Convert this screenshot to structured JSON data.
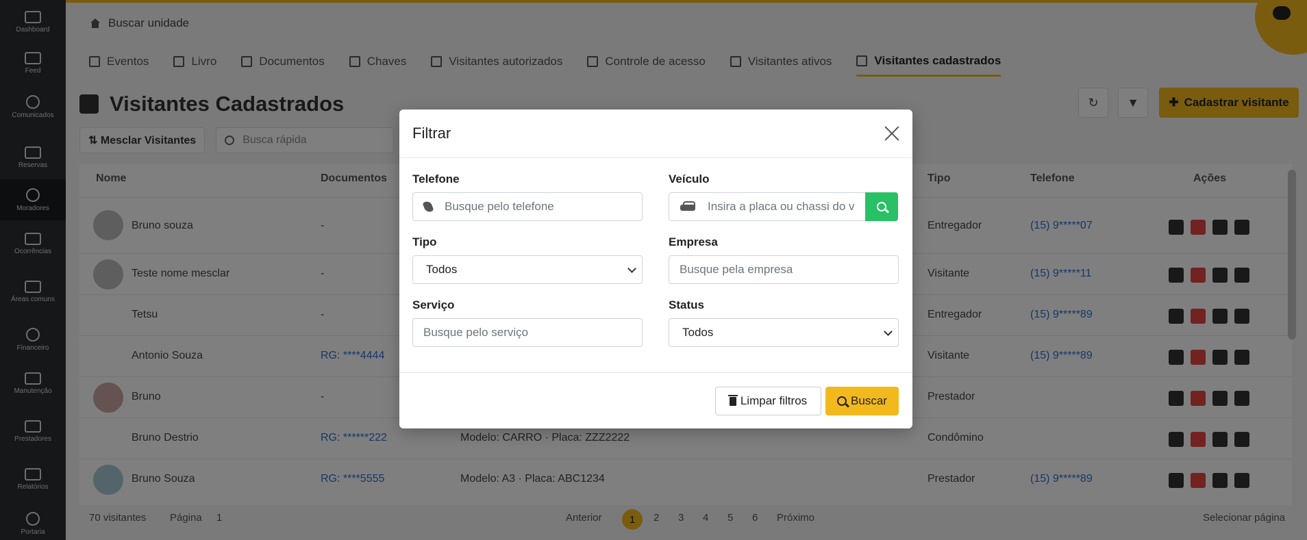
{
  "nav": {
    "items": [
      {
        "label": "Dashboard",
        "top": 0
      },
      {
        "label": "Feed"
      },
      {
        "label": "Comunicados"
      },
      {
        "label": "Reservas"
      },
      {
        "label": "Moradores"
      },
      {
        "label": "Ocorrências"
      },
      {
        "label": "Áreas comuns"
      },
      {
        "label": "Financeiro"
      },
      {
        "label": "Manutenção"
      },
      {
        "label": "Prestadores"
      },
      {
        "label": "Relatórios"
      },
      {
        "label": "Portaria"
      }
    ]
  },
  "header": {
    "breadcrumb": "Buscar unidade"
  },
  "tabs": [
    "Eventos",
    "Livro",
    "Documentos",
    "Chaves",
    "Visitantes autorizados",
    "Controle de acesso",
    "Visitantes ativos",
    "Visitantes cadastrados"
  ],
  "page": {
    "title": "Visitantes Cadastrados",
    "add_button": "Cadastrar visitante",
    "merge_button": "Mesclar Visitantes",
    "quick_search_placeholder": "Busca rápida"
  },
  "table": {
    "headers": [
      "Nome",
      "Documentos",
      "Tipo",
      "Telefone",
      "Ações"
    ],
    "rows": [
      {
        "name": "Bruno souza",
        "document": "-",
        "vehicle": "",
        "type": "Entregador",
        "phone": "(15) 9*****07"
      },
      {
        "name": "Teste nome mesclar",
        "document": "-",
        "vehicle": "",
        "type": "Visitante",
        "phone": "(15) 9*****11"
      },
      {
        "name": "Tetsu",
        "document": "-",
        "vehicle": "",
        "type": "Entregador",
        "phone": "(15) 9*****89"
      },
      {
        "name": "Antonio Souza",
        "document": "RG: ****4444",
        "vehicle": "",
        "type": "Visitante",
        "phone": "(15) 9*****89"
      },
      {
        "name": "Bruno",
        "document": "-",
        "vehicle": "",
        "type": "Prestador",
        "phone": ""
      },
      {
        "name": "Bruno Destrio",
        "document": "RG: ******222",
        "vehicle": "Modelo: CARRO · Placa: ZZZ2222",
        "type": "Condômino",
        "phone": ""
      },
      {
        "name": "Bruno Souza",
        "document": "RG: ****5555",
        "vehicle": "Modelo: A3 · Placa: ABC1234",
        "type": "Prestador",
        "phone": "(15) 9*****89"
      }
    ]
  },
  "pager": {
    "summary": "70 visitantes",
    "page_label": "Página",
    "page_value": "1",
    "prev": "Anterior",
    "pages": [
      "1",
      "2",
      "3",
      "4",
      "5",
      "6"
    ],
    "next": "Próximo",
    "select_all": "Selecionar página"
  },
  "modal": {
    "title": "Filtrar",
    "telefone": {
      "label": "Telefone",
      "placeholder": "Busque pelo telefone"
    },
    "veiculo": {
      "label": "Veículo",
      "placeholder": "Insira a placa ou chassi do v"
    },
    "tipo": {
      "label": "Tipo",
      "value": "Todos"
    },
    "empresa": {
      "label": "Empresa",
      "placeholder": "Busque pela empresa"
    },
    "servico": {
      "label": "Serviço",
      "placeholder": "Busque pelo serviço"
    },
    "status": {
      "label": "Status",
      "value": "Todos"
    },
    "clear_button": "Limpar filtros",
    "search_button": "Buscar"
  },
  "colors": {
    "accent": "#f2b91d",
    "success": "#28c166",
    "link": "#2a6fd6",
    "danger": "#e64545"
  }
}
